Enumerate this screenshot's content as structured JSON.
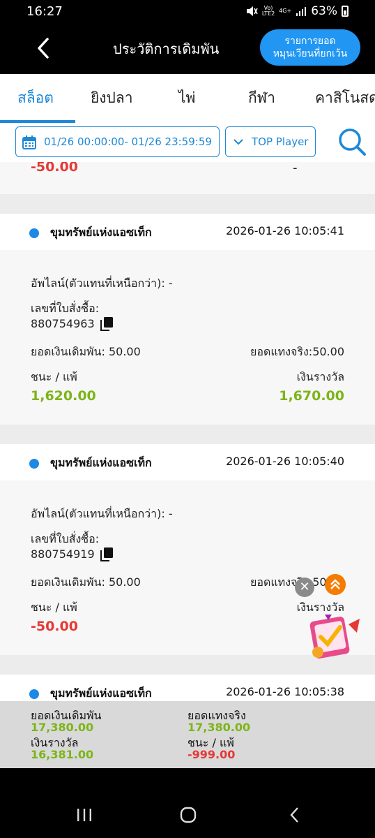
{
  "status": {
    "time": "16:27",
    "net_a": "Vo)",
    "net_b": "LTE2",
    "net_c": "4G+",
    "battery": "63%"
  },
  "header": {
    "title": "ประวัติการเดิมพัน",
    "turnover_line1": "รายการยอด",
    "turnover_line2": "หมุนเวียนที่ยกเว้น"
  },
  "tabs": [
    "สล็อต",
    "ยิงปลา",
    "ไพ่",
    "กีฬา",
    "คาสิโนสด"
  ],
  "filter": {
    "date_range": "01/26 00:00:00- 01/26 23:59:59",
    "player": "TOP Player"
  },
  "partial_record": {
    "winloss": "-50.00",
    "prize": "-"
  },
  "records": [
    {
      "game": "ขุมทรัพย์แห่งแอซเท็ก",
      "time": "2026-01-26 10:05:41",
      "upline": "อัพไลน์(ตัวแทนที่เหนือกว่า): -",
      "order_label": "เลขที่ใบสั่งซื้อ:",
      "order_no": "880754963",
      "bet": "ยอดเงินเดิมพัน: 50.00",
      "actual": "ยอดแทงจริง:50.00",
      "winloss_label": "ชนะ / แพ้",
      "winloss": "1,620.00",
      "prize_label": "เงินรางวัล",
      "prize": "1,670.00"
    },
    {
      "game": "ขุมทรัพย์แห่งแอซเท็ก",
      "time": "2026-01-26 10:05:40",
      "upline": "อัพไลน์(ตัวแทนที่เหนือกว่า): -",
      "order_label": "เลขที่ใบสั่งซื้อ:",
      "order_no": "880754919",
      "bet": "ยอดเงินเดิมพัน: 50.00",
      "actual": "ยอดแทงจริง:50.00",
      "winloss_label": "ชนะ / แพ้",
      "winloss": "-50.00",
      "prize_label": "เงินรางวัล",
      "prize": "-"
    },
    {
      "game": "ขุมทรัพย์แห่งแอซเท็ก",
      "time": "2026-01-26 10:05:38"
    }
  ],
  "summary": {
    "bet_label": "ยอดเงินเดิมพัน",
    "bet_value": "17,380.00",
    "actual_label": "ยอดแทงจริง",
    "actual_value": "17,380.00",
    "prize_label": "เงินรางวัล",
    "prize_value": "16,381.00",
    "winloss_label": "ชนะ / แพ้",
    "winloss_value": "-999.00"
  },
  "colors": {
    "accent": "#1e88d6",
    "win": "#7cb518",
    "loss": "#e53935",
    "button": "#2196f3"
  }
}
